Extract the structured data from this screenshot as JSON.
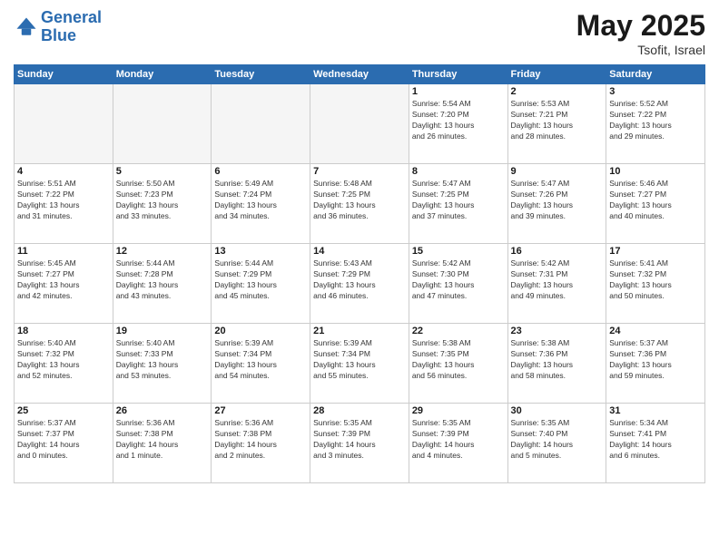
{
  "header": {
    "logo_line1": "General",
    "logo_line2": "Blue",
    "month": "May 2025",
    "location": "Tsofit, Israel"
  },
  "weekdays": [
    "Sunday",
    "Monday",
    "Tuesday",
    "Wednesday",
    "Thursday",
    "Friday",
    "Saturday"
  ],
  "weeks": [
    [
      {
        "day": "",
        "info": ""
      },
      {
        "day": "",
        "info": ""
      },
      {
        "day": "",
        "info": ""
      },
      {
        "day": "",
        "info": ""
      },
      {
        "day": "1",
        "info": "Sunrise: 5:54 AM\nSunset: 7:20 PM\nDaylight: 13 hours\nand 26 minutes."
      },
      {
        "day": "2",
        "info": "Sunrise: 5:53 AM\nSunset: 7:21 PM\nDaylight: 13 hours\nand 28 minutes."
      },
      {
        "day": "3",
        "info": "Sunrise: 5:52 AM\nSunset: 7:22 PM\nDaylight: 13 hours\nand 29 minutes."
      }
    ],
    [
      {
        "day": "4",
        "info": "Sunrise: 5:51 AM\nSunset: 7:22 PM\nDaylight: 13 hours\nand 31 minutes."
      },
      {
        "day": "5",
        "info": "Sunrise: 5:50 AM\nSunset: 7:23 PM\nDaylight: 13 hours\nand 33 minutes."
      },
      {
        "day": "6",
        "info": "Sunrise: 5:49 AM\nSunset: 7:24 PM\nDaylight: 13 hours\nand 34 minutes."
      },
      {
        "day": "7",
        "info": "Sunrise: 5:48 AM\nSunset: 7:25 PM\nDaylight: 13 hours\nand 36 minutes."
      },
      {
        "day": "8",
        "info": "Sunrise: 5:47 AM\nSunset: 7:25 PM\nDaylight: 13 hours\nand 37 minutes."
      },
      {
        "day": "9",
        "info": "Sunrise: 5:47 AM\nSunset: 7:26 PM\nDaylight: 13 hours\nand 39 minutes."
      },
      {
        "day": "10",
        "info": "Sunrise: 5:46 AM\nSunset: 7:27 PM\nDaylight: 13 hours\nand 40 minutes."
      }
    ],
    [
      {
        "day": "11",
        "info": "Sunrise: 5:45 AM\nSunset: 7:27 PM\nDaylight: 13 hours\nand 42 minutes."
      },
      {
        "day": "12",
        "info": "Sunrise: 5:44 AM\nSunset: 7:28 PM\nDaylight: 13 hours\nand 43 minutes."
      },
      {
        "day": "13",
        "info": "Sunrise: 5:44 AM\nSunset: 7:29 PM\nDaylight: 13 hours\nand 45 minutes."
      },
      {
        "day": "14",
        "info": "Sunrise: 5:43 AM\nSunset: 7:29 PM\nDaylight: 13 hours\nand 46 minutes."
      },
      {
        "day": "15",
        "info": "Sunrise: 5:42 AM\nSunset: 7:30 PM\nDaylight: 13 hours\nand 47 minutes."
      },
      {
        "day": "16",
        "info": "Sunrise: 5:42 AM\nSunset: 7:31 PM\nDaylight: 13 hours\nand 49 minutes."
      },
      {
        "day": "17",
        "info": "Sunrise: 5:41 AM\nSunset: 7:32 PM\nDaylight: 13 hours\nand 50 minutes."
      }
    ],
    [
      {
        "day": "18",
        "info": "Sunrise: 5:40 AM\nSunset: 7:32 PM\nDaylight: 13 hours\nand 52 minutes."
      },
      {
        "day": "19",
        "info": "Sunrise: 5:40 AM\nSunset: 7:33 PM\nDaylight: 13 hours\nand 53 minutes."
      },
      {
        "day": "20",
        "info": "Sunrise: 5:39 AM\nSunset: 7:34 PM\nDaylight: 13 hours\nand 54 minutes."
      },
      {
        "day": "21",
        "info": "Sunrise: 5:39 AM\nSunset: 7:34 PM\nDaylight: 13 hours\nand 55 minutes."
      },
      {
        "day": "22",
        "info": "Sunrise: 5:38 AM\nSunset: 7:35 PM\nDaylight: 13 hours\nand 56 minutes."
      },
      {
        "day": "23",
        "info": "Sunrise: 5:38 AM\nSunset: 7:36 PM\nDaylight: 13 hours\nand 58 minutes."
      },
      {
        "day": "24",
        "info": "Sunrise: 5:37 AM\nSunset: 7:36 PM\nDaylight: 13 hours\nand 59 minutes."
      }
    ],
    [
      {
        "day": "25",
        "info": "Sunrise: 5:37 AM\nSunset: 7:37 PM\nDaylight: 14 hours\nand 0 minutes."
      },
      {
        "day": "26",
        "info": "Sunrise: 5:36 AM\nSunset: 7:38 PM\nDaylight: 14 hours\nand 1 minute."
      },
      {
        "day": "27",
        "info": "Sunrise: 5:36 AM\nSunset: 7:38 PM\nDaylight: 14 hours\nand 2 minutes."
      },
      {
        "day": "28",
        "info": "Sunrise: 5:35 AM\nSunset: 7:39 PM\nDaylight: 14 hours\nand 3 minutes."
      },
      {
        "day": "29",
        "info": "Sunrise: 5:35 AM\nSunset: 7:39 PM\nDaylight: 14 hours\nand 4 minutes."
      },
      {
        "day": "30",
        "info": "Sunrise: 5:35 AM\nSunset: 7:40 PM\nDaylight: 14 hours\nand 5 minutes."
      },
      {
        "day": "31",
        "info": "Sunrise: 5:34 AM\nSunset: 7:41 PM\nDaylight: 14 hours\nand 6 minutes."
      }
    ]
  ]
}
